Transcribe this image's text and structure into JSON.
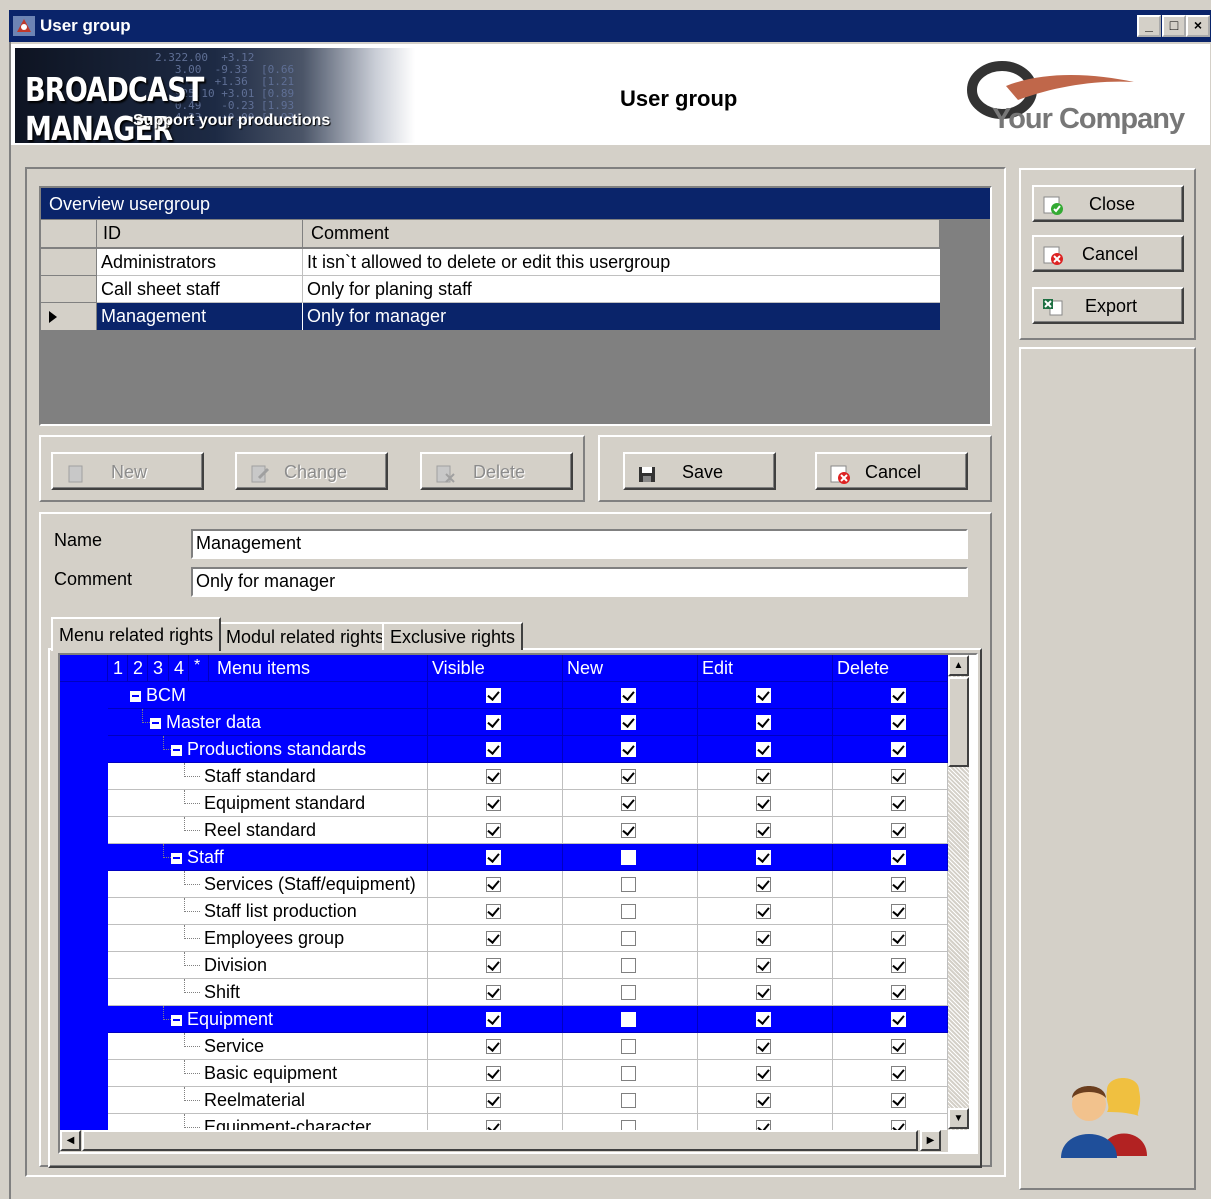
{
  "window": {
    "title": "User group"
  },
  "header": {
    "logo_title": "BROADCAST MANAGER",
    "logo_subtitle": "Support your productions",
    "page_title": "User group",
    "company": "Your Company"
  },
  "overview": {
    "title": "Overview usergroup",
    "columns": [
      "ID",
      "Comment"
    ],
    "rows": [
      {
        "id": "Administrators",
        "comment": "It isn`t allowed to delete or edit this usergroup"
      },
      {
        "id": "Call sheet staff",
        "comment": "Only for planing staff"
      },
      {
        "id": "Management",
        "comment": "Only for manager"
      }
    ],
    "selected_index": 2
  },
  "toolbar": {
    "new": "New",
    "change": "Change",
    "delete": "Delete",
    "save": "Save",
    "cancel": "Cancel"
  },
  "side": {
    "close": "Close",
    "cancel": "Cancel",
    "export": "Export"
  },
  "form": {
    "name_label": "Name",
    "name_value": "Management",
    "comment_label": "Comment",
    "comment_value": "Only for manager"
  },
  "tabs": [
    "Menu related rights",
    "Modul related rights",
    "Exclusive rights"
  ],
  "rights": {
    "levels": [
      "1",
      "2",
      "3",
      "4",
      "*"
    ],
    "columns": [
      "Menu items",
      "Visible",
      "New",
      "Edit",
      "Delete"
    ],
    "rows": [
      {
        "label": "BCM",
        "level": 0,
        "group": true,
        "v": true,
        "n": true,
        "e": true,
        "d": true
      },
      {
        "label": "Master data",
        "level": 1,
        "group": true,
        "v": true,
        "n": true,
        "e": true,
        "d": true
      },
      {
        "label": "Productions standards",
        "level": 2,
        "group": true,
        "v": true,
        "n": true,
        "e": true,
        "d": true
      },
      {
        "label": "Staff standard",
        "level": 3,
        "group": false,
        "v": true,
        "n": true,
        "e": true,
        "d": true
      },
      {
        "label": "Equipment standard",
        "level": 3,
        "group": false,
        "v": true,
        "n": true,
        "e": true,
        "d": true
      },
      {
        "label": "Reel standard",
        "level": 3,
        "group": false,
        "v": true,
        "n": true,
        "e": true,
        "d": true
      },
      {
        "label": "Staff",
        "level": 2,
        "group": true,
        "v": true,
        "n": false,
        "e": true,
        "d": true
      },
      {
        "label": "Services (Staff/equipment)",
        "level": 3,
        "group": false,
        "v": true,
        "n": false,
        "e": true,
        "d": true
      },
      {
        "label": "Staff list production",
        "level": 3,
        "group": false,
        "v": true,
        "n": false,
        "e": true,
        "d": true
      },
      {
        "label": "Employees group",
        "level": 3,
        "group": false,
        "v": true,
        "n": false,
        "e": true,
        "d": true
      },
      {
        "label": "Division",
        "level": 3,
        "group": false,
        "v": true,
        "n": false,
        "e": true,
        "d": true
      },
      {
        "label": "Shift",
        "level": 3,
        "group": false,
        "v": true,
        "n": false,
        "e": true,
        "d": true
      },
      {
        "label": "Equipment",
        "level": 2,
        "group": true,
        "v": true,
        "n": false,
        "e": true,
        "d": true
      },
      {
        "label": "Service",
        "level": 3,
        "group": false,
        "v": true,
        "n": false,
        "e": true,
        "d": true
      },
      {
        "label": "Basic equipment",
        "level": 3,
        "group": false,
        "v": true,
        "n": false,
        "e": true,
        "d": true
      },
      {
        "label": "Reelmaterial",
        "level": 3,
        "group": false,
        "v": true,
        "n": false,
        "e": true,
        "d": true
      },
      {
        "label": "Equipment-character",
        "level": 3,
        "group": false,
        "v": true,
        "n": false,
        "e": true,
        "d": true
      }
    ]
  },
  "colors": {
    "title_bar": "#0a246a",
    "selection": "#0a246a",
    "tree_group": "#0000ff",
    "face": "#d4d0c8"
  }
}
